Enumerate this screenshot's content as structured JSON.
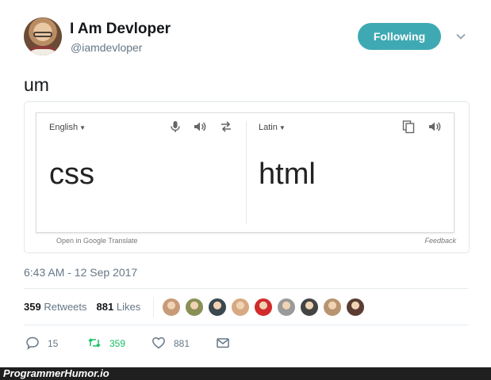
{
  "user": {
    "display_name": "I Am Devloper",
    "handle": "@iamdevloper",
    "follow_label": "Following"
  },
  "tweet": {
    "text": "um",
    "timestamp": "6:43 AM - 12 Sep 2017"
  },
  "translate_card": {
    "source_lang": "English",
    "target_lang": "Latin",
    "source_text": "css",
    "target_text": "html",
    "open_link": "Open in Google Translate",
    "feedback": "Feedback"
  },
  "stats": {
    "retweets_count": "359",
    "retweets_label": "Retweets",
    "likes_count": "881",
    "likes_label": "Likes"
  },
  "likers": [
    {
      "color": "#c89a78"
    },
    {
      "color": "#8a8f55"
    },
    {
      "color": "#3c4750"
    },
    {
      "color": "#d7a983"
    },
    {
      "color": "#d12b2b"
    },
    {
      "color": "#9a9a9a"
    },
    {
      "color": "#444444"
    },
    {
      "color": "#b99470"
    },
    {
      "color": "#5a3c33"
    }
  ],
  "actions": {
    "reply_count": "15",
    "retweet_count": "359",
    "like_count": "881"
  },
  "watermark": "ProgrammerHumor.io",
  "colors": {
    "follow_button": "#3fa9b3",
    "retweet_green": "#17bf63",
    "muted_text": "#657786"
  }
}
